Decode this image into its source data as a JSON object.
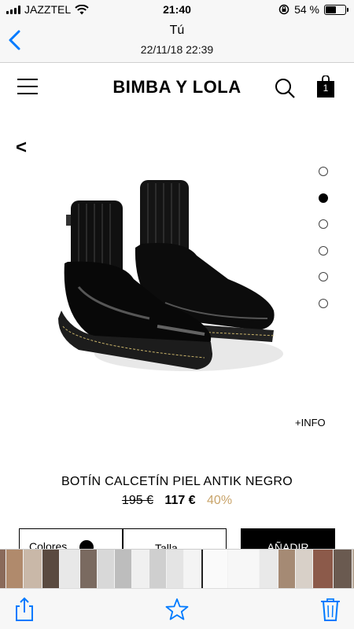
{
  "status_bar": {
    "carrier": "JAZZTEL",
    "time": "21:40",
    "battery": "54 %",
    "battery_level": 0.54
  },
  "nav": {
    "title": "Tú",
    "subtitle": "22/11/18 22:39"
  },
  "store": {
    "brand": "BIMBA Y LOLA",
    "bag_count": "1"
  },
  "product": {
    "back_label": "<",
    "more_info_label": "+INFO",
    "name": "BOTÍN CALCETÍN PIEL ANTIK NEGRO",
    "price_old": "195 €",
    "price_new": "117 €",
    "discount": "40%",
    "image_count": 6,
    "active_image_index": 1
  },
  "actions": {
    "colors_label": "Colores",
    "size_label": "Talla",
    "add_label": "AÑADIR"
  },
  "colors": {
    "accent": "#007aff",
    "discount": "#c9a46a",
    "swatch": "#000000"
  },
  "icons": {
    "back": "chevron-left-icon",
    "menu": "hamburger-icon",
    "search": "search-icon",
    "bag": "shopping-bag-icon",
    "share": "share-icon",
    "favorite": "star-icon",
    "delete": "trash-icon"
  }
}
